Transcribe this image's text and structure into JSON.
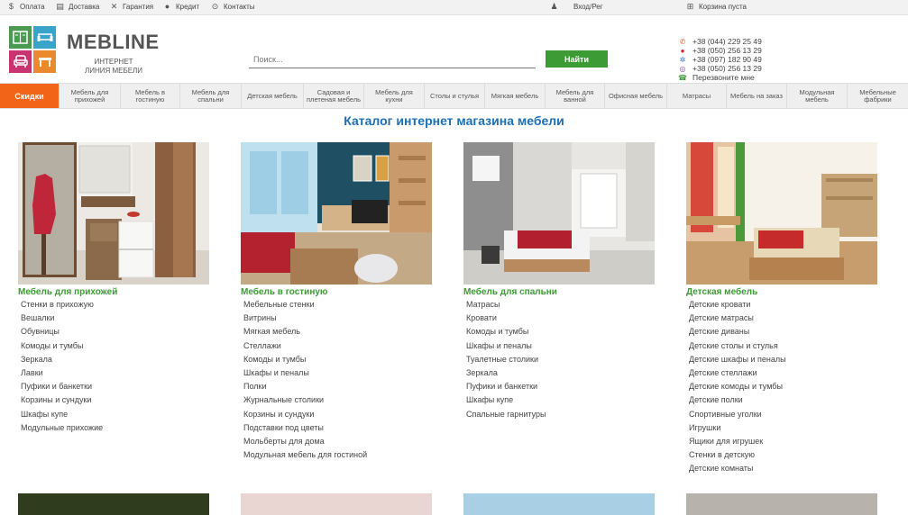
{
  "topbar": {
    "payment": "Оплата",
    "delivery": "Доставка",
    "warranty": "Гарантия",
    "credit": "Кредит",
    "contacts": "Контакты",
    "login": "Вход/Рег",
    "cart": "Корзина пуста"
  },
  "logo": {
    "name": "MEBLINE",
    "subtitle": "ИНТЕРНЕТ ЛИНИЯ МЕБЕЛИ"
  },
  "search": {
    "placeholder": "Поиск...",
    "button": "Найти"
  },
  "phones": {
    "items": [
      "+38 (044) 229 25 49",
      "+38 (050) 256 13 29",
      "+38 (097) 182 90 49",
      "+38 (050) 256 13 29"
    ],
    "callback": "Перезвоните мне"
  },
  "nav": {
    "items": [
      "Скидки",
      "Мебель для прихожей",
      "Мебель в гостиную",
      "Мебель для спальни",
      "Детская мебель",
      "Садовая и плетеная мебель",
      "Мебель для кухни",
      "Столы и стулья",
      "Мягкая мебель",
      "Мебель для ванной",
      "Офисная мебель",
      "Матрасы",
      "Мебель на заказ",
      "Модульная мебель",
      "Мебельные фабрики"
    ]
  },
  "catalog": {
    "title": "Каталог интернет магазина мебели",
    "categories": [
      {
        "title": "Мебель для прихожей",
        "items": [
          "Стенки в прихожую",
          "Вешалки",
          "Обувницы",
          "Комоды и тумбы",
          "Зеркала",
          "Лавки",
          "Пуфики и банкетки",
          "Корзины и сундуки",
          "Шкафы купе",
          "Модульные прихожие"
        ]
      },
      {
        "title": "Мебель в гостиную",
        "items": [
          "Мебельные стенки",
          "Витрины",
          "Мягкая мебель",
          "Стеллажи",
          "Комоды и тумбы",
          "Шкафы и пеналы",
          "Полки",
          "Журнальные столики",
          "Корзины и сундуки",
          "Подставки под цветы",
          "Мольберты для дома",
          "Модульная мебель для гостиной"
        ]
      },
      {
        "title": "Мебель для спальни",
        "items": [
          "Матрасы",
          "Кровати",
          "Комоды и тумбы",
          "Шкафы и пеналы",
          "Туалетные столики",
          "Зеркала",
          "Пуфики и банкетки",
          "Шкафы купе",
          "Спальные гарнитуры"
        ]
      },
      {
        "title": "Детская мебель",
        "items": [
          "Детские кровати",
          "Детские матрасы",
          "Детские диваны",
          "Детские столы и стулья",
          "Детские шкафы и пеналы",
          "Детские стеллажи",
          "Детские комоды и тумбы",
          "Детские полки",
          "Спортивные уголки",
          "Игрушки",
          "Ящики для игрушек",
          "Стенки в детскую",
          "Детские комнаты"
        ]
      }
    ]
  }
}
